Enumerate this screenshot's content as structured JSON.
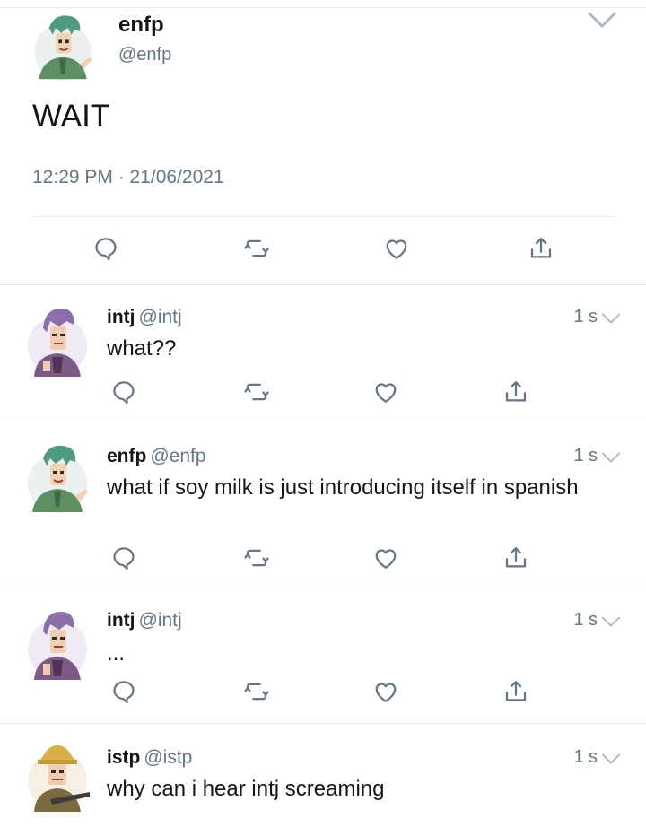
{
  "main": {
    "name": "enfp",
    "handle": "@enfp",
    "text": "WAIT",
    "timestamp": "12:29 PM · 21/06/2021",
    "avatar_icon": "enfp-character-avatar"
  },
  "replies": [
    {
      "name": "intj",
      "handle": "@intj",
      "time": "1 s",
      "text": "what??",
      "avatar_icon": "intj-character-avatar"
    },
    {
      "name": "enfp",
      "handle": "@enfp",
      "time": "1 s",
      "text": "what if soy milk is just introducing itself in spanish",
      "avatar_icon": "enfp-character-avatar"
    },
    {
      "name": "intj",
      "handle": "@intj",
      "time": "1 s",
      "text": "...",
      "avatar_icon": "intj-character-avatar"
    },
    {
      "name": "istp",
      "handle": "@istp",
      "time": "1 s",
      "text": "why can i hear intj screaming",
      "avatar_icon": "istp-character-avatar"
    }
  ],
  "icons": {
    "reply": "reply-icon",
    "retweet": "retweet-icon",
    "like": "like-icon",
    "share": "share-icon",
    "menu": "chevron-down-icon"
  },
  "colors": {
    "text": "#14171a",
    "secondary": "#657786",
    "divider": "#e1e8ed",
    "enfp_green": "#4f9a83",
    "intj_purple": "#8b6fa8",
    "istp_yellow": "#d8b048"
  }
}
